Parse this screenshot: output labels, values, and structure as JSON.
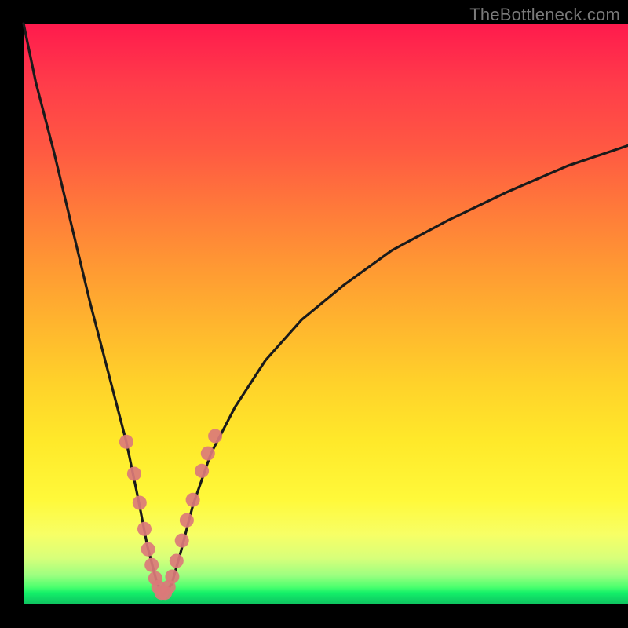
{
  "watermark": "TheBottleneck.com",
  "colors": {
    "gradient_top": "#ff1a4d",
    "gradient_bottom": "#0fc25f",
    "curve_stroke": "#1a1a1a",
    "marker_fill": "#db7a7a",
    "frame": "#000000"
  },
  "chart_data": {
    "type": "line",
    "title": "",
    "xlabel": "",
    "ylabel": "",
    "xlim": [
      0,
      100
    ],
    "ylim": [
      0,
      100
    ],
    "note": "Axes are unlabeled so values are estimated as percentages of the plot area. y=0 is bottom (green, ideal); y=100 is top (red, worst). Curve is a V-shaped bottleneck curve with minimum near x≈23.",
    "series": [
      {
        "name": "bottleneck-curve",
        "x": [
          0,
          2,
          5,
          8,
          11,
          14,
          17,
          19,
          20.5,
          22,
          23,
          24.5,
          26,
          28,
          31,
          35,
          40,
          46,
          53,
          61,
          70,
          80,
          90,
          100
        ],
        "y": [
          100,
          90,
          78,
          65,
          52,
          40,
          28,
          18,
          10,
          4,
          1.5,
          3.5,
          9,
          17,
          26,
          34,
          42,
          49,
          55,
          61,
          66,
          71,
          75.5,
          79
        ]
      },
      {
        "name": "sample-markers",
        "x": [
          17.0,
          18.3,
          19.2,
          20.0,
          20.6,
          21.2,
          21.8,
          22.3,
          22.8,
          23.4,
          24.0,
          24.6,
          25.3,
          26.2,
          27.0,
          28.0,
          29.5,
          30.5,
          31.7
        ],
        "y": [
          28.0,
          22.5,
          17.5,
          13.0,
          9.5,
          6.8,
          4.5,
          3.0,
          2.0,
          2.0,
          3.0,
          4.8,
          7.5,
          11.0,
          14.5,
          18.0,
          23.0,
          26.0,
          29.0
        ]
      }
    ]
  }
}
